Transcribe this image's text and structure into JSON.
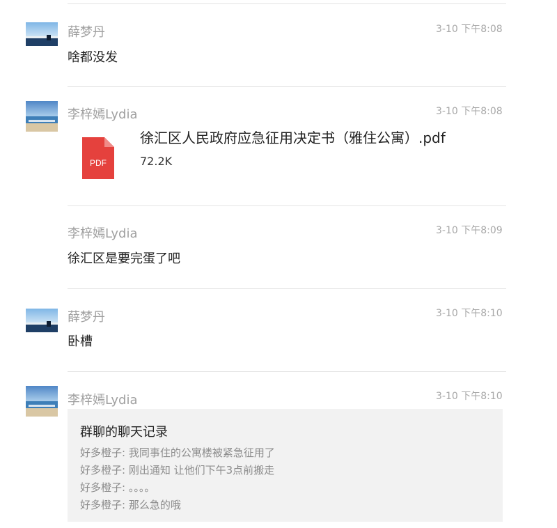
{
  "messages": [
    {
      "sender": "薛梦丹",
      "time": "3-10 下午8:08",
      "text": "啥都没发"
    },
    {
      "sender": "李梓嫣Lydia",
      "time": "3-10 下午8:08",
      "file": {
        "type_label": "PDF",
        "name": "徐汇区人民政府应急征用决定书（雅住公寓）.pdf",
        "size": "72.2K"
      }
    },
    {
      "sender": "李梓嫣Lydia",
      "time": "3-10 下午8:09",
      "text": "徐汇区是要完蛋了吧"
    },
    {
      "sender": "薛梦丹",
      "time": "3-10 下午8:10",
      "text": "卧槽"
    },
    {
      "sender": "李梓嫣Lydia",
      "time": "3-10 下午8:10",
      "chat_record": {
        "title": "群聊的聊天记录",
        "lines": [
          "好多橙子: 我同事住的公寓楼被紧急征用了",
          "好多橙子: 刚出通知 让他们下午3点前搬走",
          "好多橙子: 。。。。",
          "好多橙子: 那么急的哦"
        ]
      }
    }
  ],
  "colors": {
    "pdf_icon": "#e5413d",
    "divider": "#e3e3e3",
    "record_bg": "#f2f2f2"
  }
}
